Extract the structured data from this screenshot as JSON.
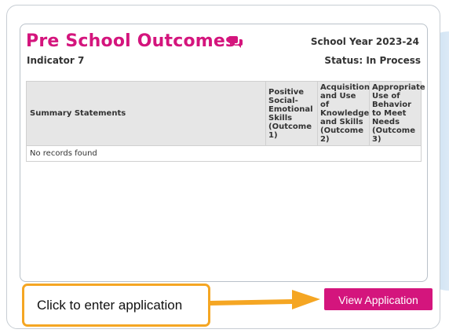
{
  "header": {
    "title": "Pre School Outcomes",
    "indicator": "Indicator 7",
    "school_year_label": "School Year",
    "school_year_value": "2023-24",
    "status_label": "Status:",
    "status_value": "In Process"
  },
  "table": {
    "columns": [
      "Summary Statements",
      "Positive Social-Emotional Skills (Outcome 1)",
      "Acquisition and Use of Knowledge and Skills (Outcome 2)",
      "Appropriate Use of Behavior to Meet Needs (Outcome 3)"
    ],
    "empty_message": "No records found"
  },
  "callout": {
    "text": "Click to enter application"
  },
  "actions": {
    "view_label": "View Application"
  },
  "colors": {
    "brand": "#d4157d",
    "callout_border": "#f5a623"
  },
  "icons": {
    "comments": "comments-icon",
    "arrow": "arrow-right-icon"
  }
}
